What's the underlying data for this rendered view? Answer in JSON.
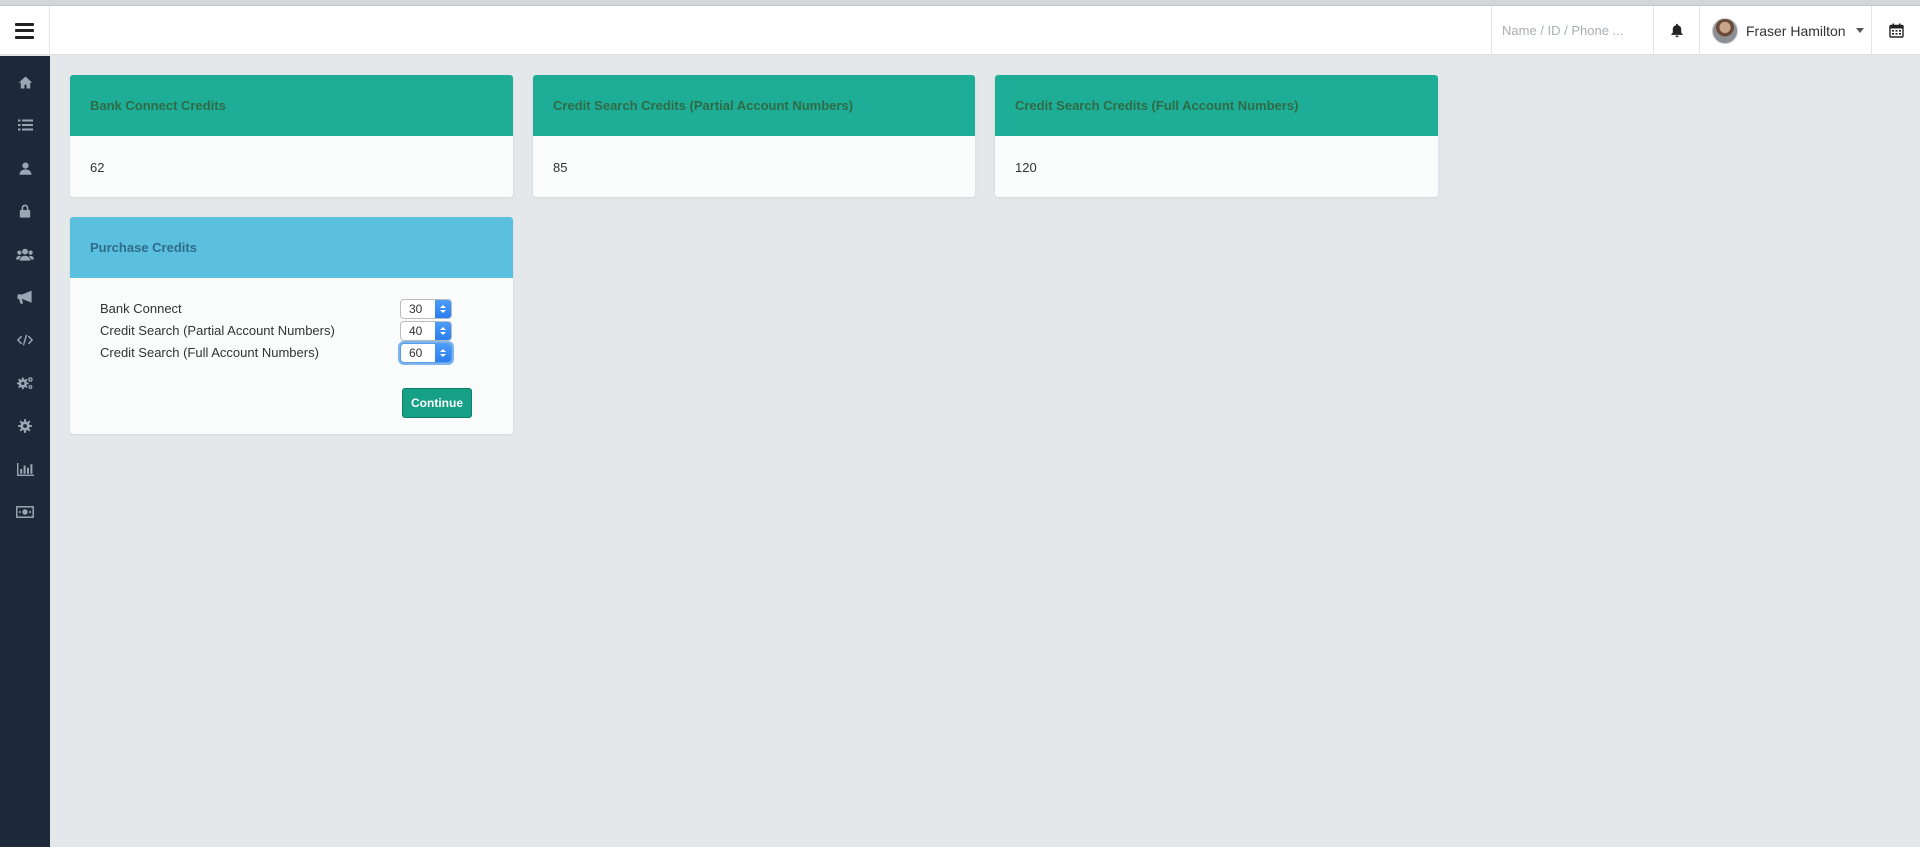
{
  "header": {
    "search_placeholder": "Name / ID / Phone ...",
    "user_name": "Fraser Hamilton"
  },
  "sidebar": {
    "items": [
      {
        "icon": "home-icon"
      },
      {
        "icon": "list-icon"
      },
      {
        "icon": "user-icon"
      },
      {
        "icon": "lock-icon"
      },
      {
        "icon": "users-icon"
      },
      {
        "icon": "megaphone-icon"
      },
      {
        "icon": "code-icon"
      },
      {
        "icon": "cogs-icon"
      },
      {
        "icon": "gear-icon"
      },
      {
        "icon": "bar-chart-icon"
      },
      {
        "icon": "money-icon"
      }
    ]
  },
  "credits": [
    {
      "title": "Bank Connect Credits",
      "value": "62"
    },
    {
      "title": "Credit Search Credits (Partial Account Numbers)",
      "value": "85"
    },
    {
      "title": "Credit Search Credits (Full Account Numbers)",
      "value": "120"
    }
  ],
  "purchase": {
    "title": "Purchase Credits",
    "rows": [
      {
        "label": "Bank Connect",
        "value": "30"
      },
      {
        "label": "Credit Search (Partial Account Numbers)",
        "value": "40"
      },
      {
        "label": "Credit Search (Full Account Numbers)",
        "value": "60"
      }
    ],
    "continue_label": "Continue"
  },
  "colors": {
    "sidebar": "#1d2939",
    "header_green": "#1eae97",
    "header_blue": "#5bc0de",
    "button": "#16a085"
  }
}
